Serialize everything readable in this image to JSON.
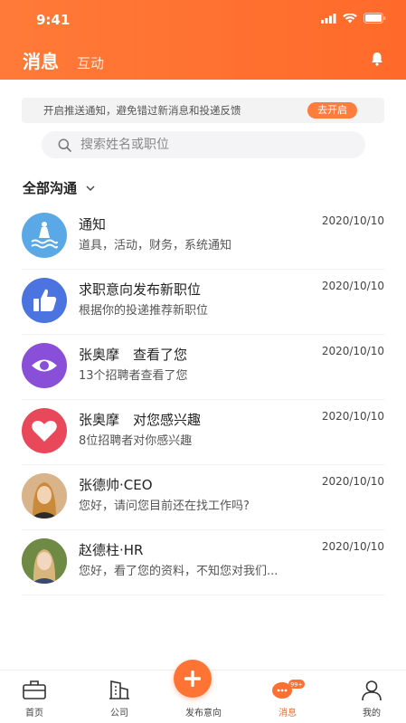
{
  "status_bar": {
    "time": "9:41"
  },
  "header": {
    "tabs": [
      {
        "label": "消息"
      },
      {
        "label": "互动"
      }
    ]
  },
  "notice": {
    "text": "开启推送通知，避免错过新消息和投递反馈",
    "action_label": "去开启"
  },
  "search": {
    "placeholder": "搜索姓名或职位"
  },
  "filter": {
    "label": "全部沟通"
  },
  "messages": [
    {
      "title": "通知",
      "subtitle": "道具，活动，财务，系统通知",
      "date": "2020/10/10",
      "icon": "notification-icon",
      "color": "#5aa9e6"
    },
    {
      "title": "求职意向发布新职位",
      "subtitle": "根据你的投递推荐新职位",
      "date": "2020/10/10",
      "icon": "thumbs-up-icon",
      "color": "#4b74e0"
    },
    {
      "title": "张奥摩　查看了您",
      "subtitle": "13个招聘者查看了您",
      "date": "2020/10/10",
      "icon": "eye-icon",
      "color": "#8a4fd8"
    },
    {
      "title": "张奥摩　对您感兴趣",
      "subtitle": "8位招聘者对你感兴趣",
      "date": "2020/10/10",
      "icon": "heart-icon",
      "color": "#e9475a"
    },
    {
      "title": "张德帅·CEO",
      "subtitle": "您好，请问您目前还在找工作吗?",
      "date": "2020/10/10",
      "icon": "avatar",
      "color": "#c98a5a"
    },
    {
      "title": "赵德柱·HR",
      "subtitle": "您好，看了您的资料，不知您对我们...",
      "date": "2020/10/10",
      "icon": "avatar",
      "color": "#7a8f4a"
    }
  ],
  "tabbar": {
    "items": [
      {
        "label": "首页",
        "icon": "briefcase-icon"
      },
      {
        "label": "公司",
        "icon": "building-icon"
      },
      {
        "label": "发布意向",
        "icon": "plus-icon"
      },
      {
        "label": "消息",
        "icon": "chat-icon",
        "badge": "99+"
      },
      {
        "label": "我的",
        "icon": "person-icon"
      }
    ]
  },
  "colors": {
    "accent": "#ff7434",
    "header": "#ff7a38"
  }
}
